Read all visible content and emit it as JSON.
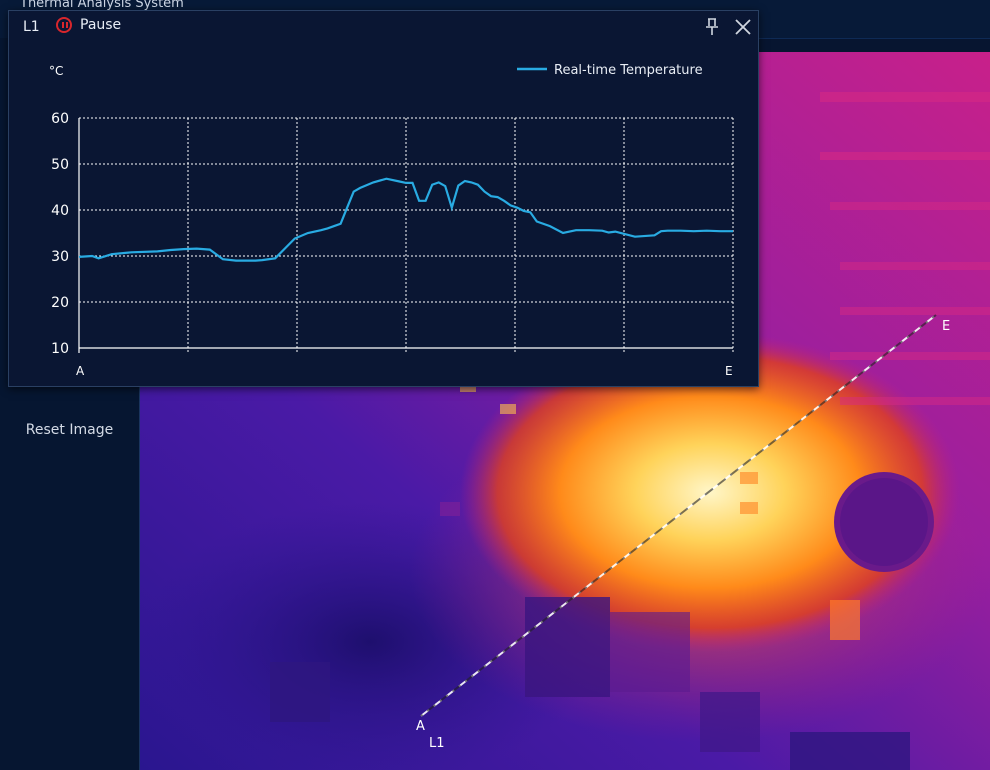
{
  "app": {
    "title": "Thermal Analysis System"
  },
  "left_panel": {
    "reset_image_label": "Reset Image"
  },
  "popup": {
    "line_id": "L1",
    "pause_label": "Pause",
    "pin_icon": "pin-icon",
    "close_icon": "close-icon"
  },
  "measurement_line": {
    "start_label": "A",
    "end_label": "E",
    "name": "L1"
  },
  "colors": {
    "series": "#29abe2",
    "pause": "#d8262c",
    "hot": "#ffe070",
    "cool": "#3a1aa0"
  },
  "chart_data": {
    "type": "line",
    "ylabel": "°C",
    "ylim": [
      10,
      60
    ],
    "yticks": [
      10,
      20,
      30,
      40,
      50,
      60
    ],
    "x_start_label": "A",
    "x_end_label": "E",
    "xlim": [
      0,
      100
    ],
    "legend_position": "top-right",
    "grid": true,
    "series": [
      {
        "name": "Real-time Temperature",
        "color": "#29abe2",
        "x": [
          0,
          2,
          3,
          5,
          8,
          12,
          14,
          16,
          18,
          20,
          22,
          24,
          26,
          27,
          28,
          30,
          33,
          35,
          37,
          38,
          39,
          40,
          41,
          42,
          43,
          45,
          47,
          49,
          50,
          51,
          52,
          53,
          54,
          55,
          56,
          57,
          58,
          59,
          60,
          61,
          62,
          63,
          64,
          65,
          66,
          67,
          68,
          69,
          70,
          72,
          74,
          75,
          76,
          78,
          80,
          81,
          82,
          85,
          88,
          89,
          90,
          91,
          92,
          94,
          96,
          98,
          100
        ],
        "y": [
          29.8,
          30.0,
          29.5,
          30.4,
          30.8,
          31.0,
          31.3,
          31.5,
          31.6,
          31.4,
          29.3,
          29.0,
          29.0,
          29.0,
          29.1,
          29.5,
          33.8,
          35.0,
          35.6,
          36.0,
          36.5,
          37.0,
          40.5,
          44.0,
          44.8,
          46.0,
          46.8,
          46.2,
          45.9,
          45.9,
          42.0,
          42.0,
          45.5,
          46.0,
          45.2,
          40.5,
          45.3,
          46.3,
          46.0,
          45.5,
          44.0,
          43.0,
          42.8,
          42.0,
          41.0,
          40.5,
          39.8,
          39.5,
          37.5,
          36.5,
          35.0,
          35.3,
          35.6,
          35.6,
          35.5,
          35.1,
          35.3,
          34.2,
          34.5,
          35.4,
          35.5,
          35.5,
          35.5,
          35.4,
          35.5,
          35.4,
          35.4
        ]
      }
    ]
  }
}
